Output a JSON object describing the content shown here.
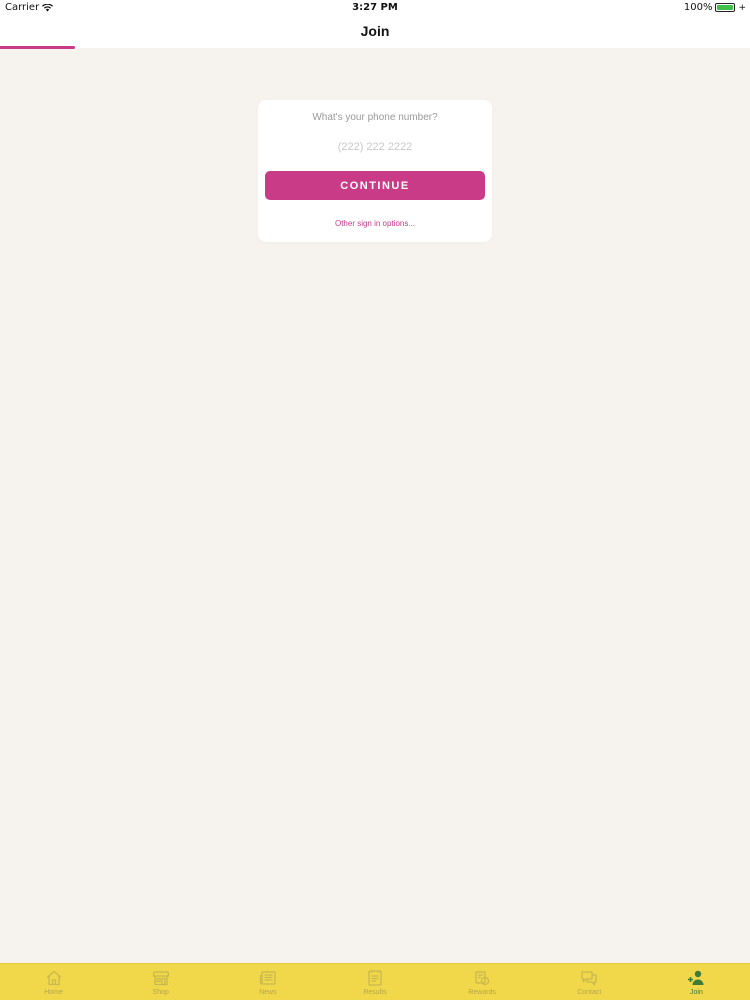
{
  "status_bar": {
    "carrier": "Carrier",
    "time": "3:27 PM",
    "battery_text": "100%",
    "battery_level": 1.0
  },
  "nav": {
    "title": "Join",
    "progress": 0.1
  },
  "join_card": {
    "prompt": "What's your phone number?",
    "phone_placeholder": "(222) 222 2222",
    "phone_value": "",
    "continue_label": "CONTINUE",
    "other_options_link": "Other sign in options..."
  },
  "tab_bar": {
    "items": [
      {
        "label": "Home",
        "icon": "home-icon",
        "active": false
      },
      {
        "label": "Shop",
        "icon": "shop-icon",
        "active": false
      },
      {
        "label": "News",
        "icon": "news-icon",
        "active": false
      },
      {
        "label": "Results",
        "icon": "results-icon",
        "active": false
      },
      {
        "label": "Rewards",
        "icon": "rewards-icon",
        "active": false
      },
      {
        "label": "Contact",
        "icon": "contact-icon",
        "active": false
      },
      {
        "label": "Join",
        "icon": "join-icon",
        "active": true
      }
    ]
  },
  "colors": {
    "accent": "#c93a87",
    "tab_bar_bg": "#f1d84a",
    "tab_icon_inactive": "#c9b84d",
    "tab_icon_active": "#3e7a3a",
    "page_bg": "#f6f3ef"
  }
}
